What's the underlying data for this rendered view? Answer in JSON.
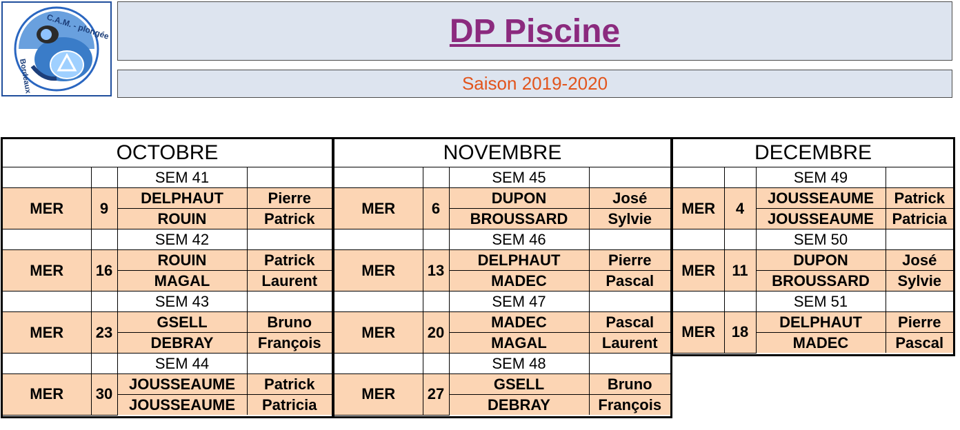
{
  "header": {
    "title": "DP Piscine",
    "season": "Saison 2019-2020"
  },
  "logo": {
    "text_top": "C.A.M. - plongée",
    "text_side": "Bordeaux"
  },
  "colors": {
    "title": "#8b2a7e",
    "season": "#e2541c",
    "header_bg": "#dde4ef",
    "row_bg": "#fcd5b4"
  },
  "months": [
    {
      "name": "OCTOBRE",
      "weeks": [
        {
          "sem": "SEM 41",
          "day": "MER",
          "date": "9",
          "people": [
            [
              "DELPHAUT",
              "Pierre"
            ],
            [
              "ROUIN",
              "Patrick"
            ]
          ]
        },
        {
          "sem": "SEM 42",
          "day": "MER",
          "date": "16",
          "people": [
            [
              "ROUIN",
              "Patrick"
            ],
            [
              "MAGAL",
              "Laurent"
            ]
          ]
        },
        {
          "sem": "SEM 43",
          "day": "MER",
          "date": "23",
          "people": [
            [
              "GSELL",
              "Bruno"
            ],
            [
              "DEBRAY",
              "François"
            ]
          ]
        },
        {
          "sem": "SEM 44",
          "day": "MER",
          "date": "30",
          "people": [
            [
              "JOUSSEAUME",
              "Patrick"
            ],
            [
              "JOUSSEAUME",
              "Patricia"
            ]
          ]
        }
      ]
    },
    {
      "name": "NOVEMBRE",
      "weeks": [
        {
          "sem": "SEM 45",
          "day": "MER",
          "date": "6",
          "people": [
            [
              "DUPON",
              "José"
            ],
            [
              "BROUSSARD",
              "Sylvie"
            ]
          ]
        },
        {
          "sem": "SEM 46",
          "day": "MER",
          "date": "13",
          "people": [
            [
              "DELPHAUT",
              "Pierre"
            ],
            [
              "MADEC",
              "Pascal"
            ]
          ]
        },
        {
          "sem": "SEM 47",
          "day": "MER",
          "date": "20",
          "people": [
            [
              "MADEC",
              "Pascal"
            ],
            [
              "MAGAL",
              "Laurent"
            ]
          ]
        },
        {
          "sem": "SEM 48",
          "day": "MER",
          "date": "27",
          "people": [
            [
              "GSELL",
              "Bruno"
            ],
            [
              "DEBRAY",
              "François"
            ]
          ]
        }
      ]
    },
    {
      "name": "DECEMBRE",
      "weeks": [
        {
          "sem": "SEM 49",
          "day": "MER",
          "date": "4",
          "people": [
            [
              "JOUSSEAUME",
              "Patrick"
            ],
            [
              "JOUSSEAUME",
              "Patricia"
            ]
          ]
        },
        {
          "sem": "SEM 50",
          "day": "MER",
          "date": "11",
          "people": [
            [
              "DUPON",
              "José"
            ],
            [
              "BROUSSARD",
              "Sylvie"
            ]
          ]
        },
        {
          "sem": "SEM 51",
          "day": "MER",
          "date": "18",
          "people": [
            [
              "DELPHAUT",
              "Pierre"
            ],
            [
              "MADEC",
              "Pascal"
            ]
          ]
        }
      ]
    }
  ]
}
